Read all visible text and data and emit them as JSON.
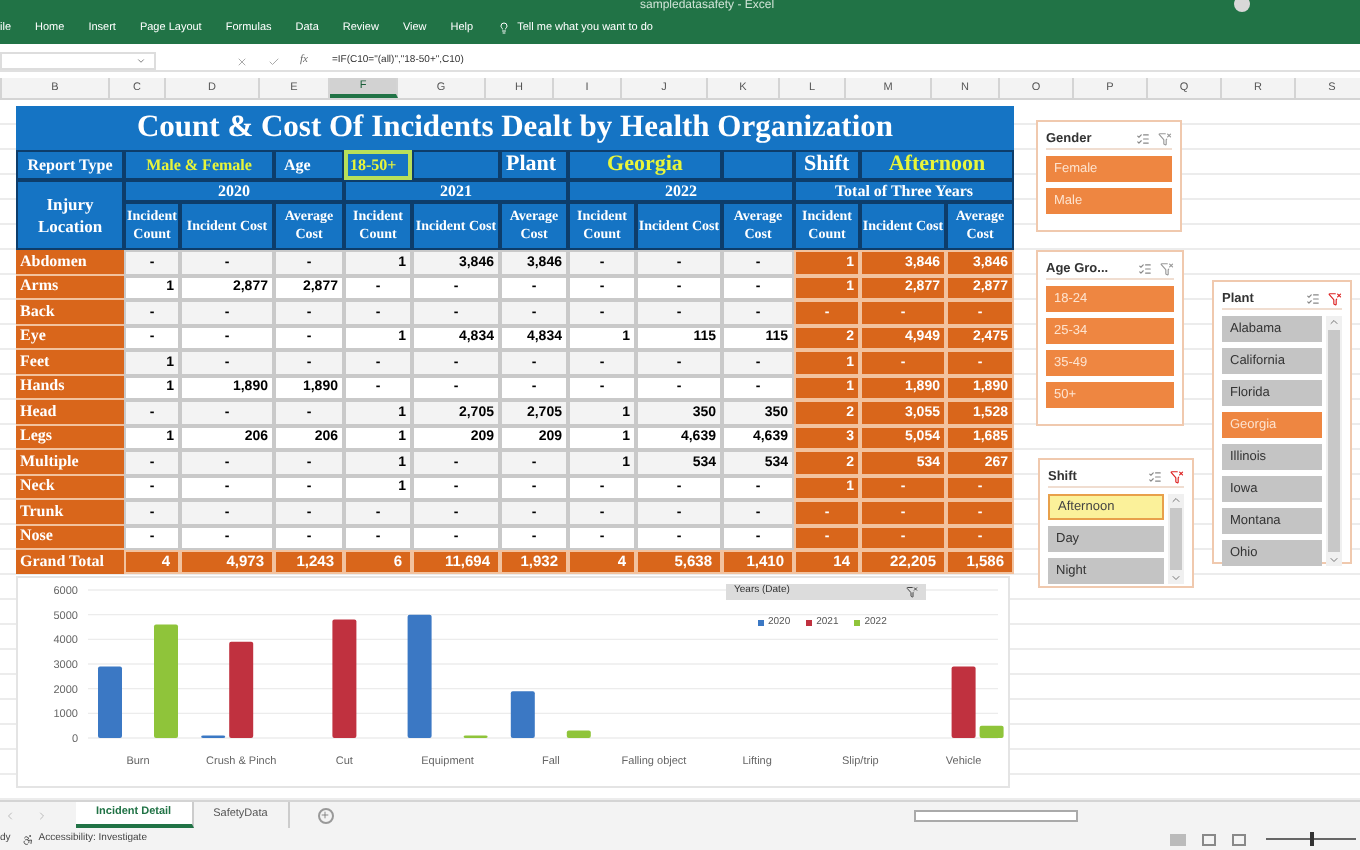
{
  "window": {
    "title": "sampledatasafety - Excel"
  },
  "ribbon_tabs": [
    "ile",
    "Home",
    "Insert",
    "Page Layout",
    "Formulas",
    "Data",
    "Review",
    "View",
    "Help"
  ],
  "tell_me": "Tell me what you want to do",
  "formula_bar": {
    "function_label": "fx",
    "formula": "=IF(C10=\"(all)\",\"18-50+\",C10)"
  },
  "column_headers": [
    {
      "label": "B",
      "selected": false
    },
    {
      "label": "C",
      "selected": false
    },
    {
      "label": "D",
      "selected": false
    },
    {
      "label": "E",
      "selected": false
    },
    {
      "label": "F",
      "selected": true
    },
    {
      "label": "G",
      "selected": false
    },
    {
      "label": "H",
      "selected": false
    },
    {
      "label": "I",
      "selected": false
    },
    {
      "label": "J",
      "selected": false
    },
    {
      "label": "K",
      "selected": false
    },
    {
      "label": "L",
      "selected": false
    },
    {
      "label": "M",
      "selected": false
    },
    {
      "label": "N",
      "selected": false
    },
    {
      "label": "O",
      "selected": false
    },
    {
      "label": "P",
      "selected": false
    },
    {
      "label": "Q",
      "selected": false
    },
    {
      "label": "R",
      "selected": false
    },
    {
      "label": "S",
      "selected": false
    }
  ],
  "report": {
    "title": "Count & Cost Of Incidents Dealt by Health Organization",
    "filters": [
      {
        "label": "Report Type",
        "value": "Male & Female",
        "active": false
      },
      {
        "label": "Age",
        "value": "18-50+",
        "active": true
      },
      {
        "label": "Plant",
        "value": "Georgia",
        "active": false
      },
      {
        "label": "Shift",
        "value": "Afternoon",
        "active": false
      }
    ],
    "row_header": "Injury Location",
    "year_groups": [
      "2020",
      "2021",
      "2022",
      "Total of Three Years"
    ],
    "column_labels": [
      "Incident Count",
      "Incident Cost",
      "Average Cost",
      "Incident Count",
      "Incident Cost",
      "Average Cost",
      "Incident Count",
      "Incident Cost",
      "Average Cost",
      "Incident Count",
      "Incident Cost",
      "Average Cost"
    ],
    "rows": [
      {
        "location": "Abdomen",
        "values": [
          "-",
          "-",
          "-",
          "1",
          "3,846",
          "3,846",
          "-",
          "-",
          "-",
          "1",
          "3,846",
          "3,846"
        ]
      },
      {
        "location": "Arms",
        "values": [
          "1",
          "2,877",
          "2,877",
          "-",
          "-",
          "-",
          "-",
          "-",
          "-",
          "1",
          "2,877",
          "2,877"
        ]
      },
      {
        "location": "Back",
        "values": [
          "-",
          "-",
          "-",
          "-",
          "-",
          "-",
          "-",
          "-",
          "-",
          "-",
          "-",
          "-"
        ]
      },
      {
        "location": "Eye",
        "values": [
          "-",
          "-",
          "-",
          "1",
          "4,834",
          "4,834",
          "1",
          "115",
          "115",
          "2",
          "4,949",
          "2,475"
        ]
      },
      {
        "location": "Feet",
        "values": [
          "1",
          "-",
          "-",
          "-",
          "-",
          "-",
          "-",
          "-",
          "-",
          "1",
          "-",
          "-"
        ]
      },
      {
        "location": "Hands",
        "values": [
          "1",
          "1,890",
          "1,890",
          "-",
          "-",
          "-",
          "-",
          "-",
          "-",
          "1",
          "1,890",
          "1,890"
        ]
      },
      {
        "location": "Head",
        "values": [
          "-",
          "-",
          "-",
          "1",
          "2,705",
          "2,705",
          "1",
          "350",
          "350",
          "2",
          "3,055",
          "1,528"
        ]
      },
      {
        "location": "Legs",
        "values": [
          "1",
          "206",
          "206",
          "1",
          "209",
          "209",
          "1",
          "4,639",
          "4,639",
          "3",
          "5,054",
          "1,685"
        ]
      },
      {
        "location": "Multiple",
        "values": [
          "-",
          "-",
          "-",
          "1",
          "-",
          "-",
          "1",
          "534",
          "534",
          "2",
          "534",
          "267"
        ]
      },
      {
        "location": "Neck",
        "values": [
          "-",
          "-",
          "-",
          "1",
          "-",
          "-",
          "-",
          "-",
          "-",
          "1",
          "-",
          "-"
        ]
      },
      {
        "location": "Trunk",
        "values": [
          "-",
          "-",
          "-",
          "-",
          "-",
          "-",
          "-",
          "-",
          "-",
          "-",
          "-",
          "-"
        ]
      },
      {
        "location": "Nose",
        "values": [
          "-",
          "-",
          "-",
          "-",
          "-",
          "-",
          "-",
          "-",
          "-",
          "-",
          "-",
          "-"
        ]
      }
    ],
    "grand_total": {
      "label": "Grand Total",
      "values": [
        "4",
        "4,973",
        "1,243",
        "6",
        "11,694",
        "1,932",
        "4",
        "5,638",
        "1,410",
        "14",
        "22,205",
        "1,586"
      ]
    }
  },
  "chart": {
    "field_button": "Years (Date)",
    "chart_data": {
      "type": "bar",
      "grid": true,
      "legend": true,
      "categories": [
        "Burn",
        "Crush & Pinch",
        "Cut",
        "Equipment",
        "Fall",
        "Falling object",
        "Lifting",
        "Slip/trip",
        "Vehicle"
      ],
      "ylim": [
        0,
        6000
      ],
      "yticks": [
        0,
        1000,
        2000,
        3000,
        4000,
        5000,
        6000
      ],
      "series": [
        {
          "name": "2020",
          "color": "#3b78c4",
          "values": [
            2900,
            100,
            null,
            5000,
            1900,
            null,
            null,
            null,
            null
          ]
        },
        {
          "name": "2021",
          "color": "#c0313f",
          "values": [
            null,
            3900,
            4800,
            null,
            null,
            null,
            null,
            null,
            2900
          ]
        },
        {
          "name": "2022",
          "color": "#8fc43a",
          "values": [
            4600,
            null,
            null,
            100,
            300,
            null,
            null,
            null,
            500
          ]
        }
      ]
    }
  },
  "slicers": [
    {
      "title": "Gender",
      "filtered": false,
      "items": [
        {
          "label": "Female",
          "selected": true,
          "hovered": false
        },
        {
          "label": "Male",
          "selected": true,
          "hovered": false
        }
      ]
    },
    {
      "title": "Age Gro...",
      "filtered": false,
      "items": [
        {
          "label": "18-24",
          "selected": true,
          "hovered": false
        },
        {
          "label": "25-34",
          "selected": true,
          "hovered": false
        },
        {
          "label": "35-49",
          "selected": true,
          "hovered": false
        },
        {
          "label": "50+",
          "selected": true,
          "hovered": false
        }
      ]
    },
    {
      "title": "Plant",
      "filtered": true,
      "items": [
        {
          "label": "Alabama",
          "selected": false,
          "hovered": false
        },
        {
          "label": "California",
          "selected": false,
          "hovered": false
        },
        {
          "label": "Florida",
          "selected": false,
          "hovered": false
        },
        {
          "label": "Georgia",
          "selected": true,
          "hovered": false
        },
        {
          "label": "Illinois",
          "selected": false,
          "hovered": false
        },
        {
          "label": "Iowa",
          "selected": false,
          "hovered": false
        },
        {
          "label": "Montana",
          "selected": false,
          "hovered": false
        },
        {
          "label": "Ohio",
          "selected": false,
          "hovered": false
        }
      ]
    },
    {
      "title": "Shift",
      "filtered": true,
      "items": [
        {
          "label": "Afternoon",
          "selected": true,
          "hovered": true
        },
        {
          "label": "Day",
          "selected": false,
          "hovered": false
        },
        {
          "label": "Night",
          "selected": false,
          "hovered": false
        }
      ]
    }
  ],
  "sheet_tabs": [
    {
      "label": "Incident Detail",
      "selected": true
    },
    {
      "label": "SafetyData",
      "selected": false
    }
  ],
  "status_bar": {
    "mode": "dy",
    "accessibility": "Accessibility: Investigate",
    "zoom": {
      "level": 0.5
    }
  }
}
